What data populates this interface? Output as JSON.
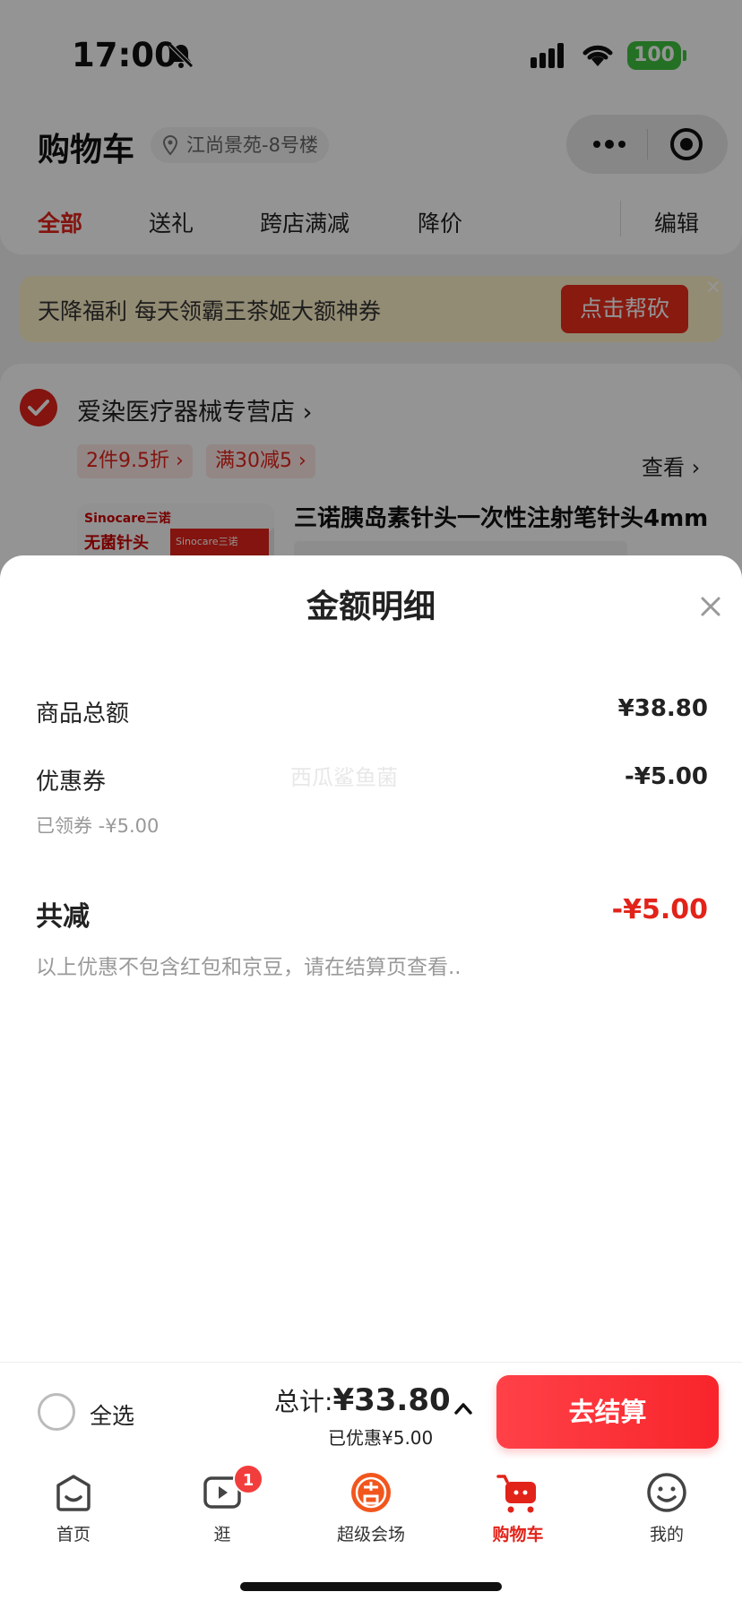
{
  "status_bar": {
    "time": "17:00",
    "battery": "100"
  },
  "header": {
    "title": "购物车",
    "location": "江尚景苑-8号楼"
  },
  "tabs": [
    {
      "label": "全部"
    },
    {
      "label": "送礼"
    },
    {
      "label": "跨店满减"
    },
    {
      "label": "降价"
    },
    {
      "label": "编辑"
    }
  ],
  "banner": {
    "text": "天降福利 每天领霸王茶姬大额神券",
    "button": "点击帮砍"
  },
  "store": {
    "name": "爱染医疗器械专营店 ›",
    "promos": [
      "2件9.5折 ›",
      "满30减5 ›"
    ],
    "view_link": "查看 ›",
    "product": {
      "title": "三诺胰岛素针头一次性注射笔针头4mm",
      "image_brand": "Sinocare三诺",
      "image_text": "无菌针头",
      "image_box": "Sinocare三诺"
    }
  },
  "sheet": {
    "title": "金额明细",
    "rows": [
      {
        "label": "商品总额",
        "value": "¥38.80"
      },
      {
        "label": "优惠券",
        "value": "-¥5.00",
        "sub": "已领券 -¥5.00"
      }
    ],
    "watermark": "西瓜鲨鱼菌",
    "total": {
      "label": "共减",
      "value": "-¥5.00"
    },
    "note": "以上优惠不包含红包和京豆，请在结算页查看.."
  },
  "checkout": {
    "select_all": "全选",
    "total_prefix": "总计:",
    "total_amount": "¥33.80",
    "discount": "已优惠¥5.00",
    "button": "去结算"
  },
  "tabbar": {
    "items": [
      {
        "label": "首页",
        "icon": "home-icon"
      },
      {
        "label": "逛",
        "icon": "video-icon",
        "badge": "1"
      },
      {
        "label": "超级会场",
        "icon": "super-venue-icon"
      },
      {
        "label": "购物车",
        "icon": "cart-icon"
      },
      {
        "label": "我的",
        "icon": "profile-icon"
      }
    ]
  },
  "colors": {
    "accent": "#e2231a",
    "checkout": "#f8252b",
    "battery": "#3ec13e"
  }
}
